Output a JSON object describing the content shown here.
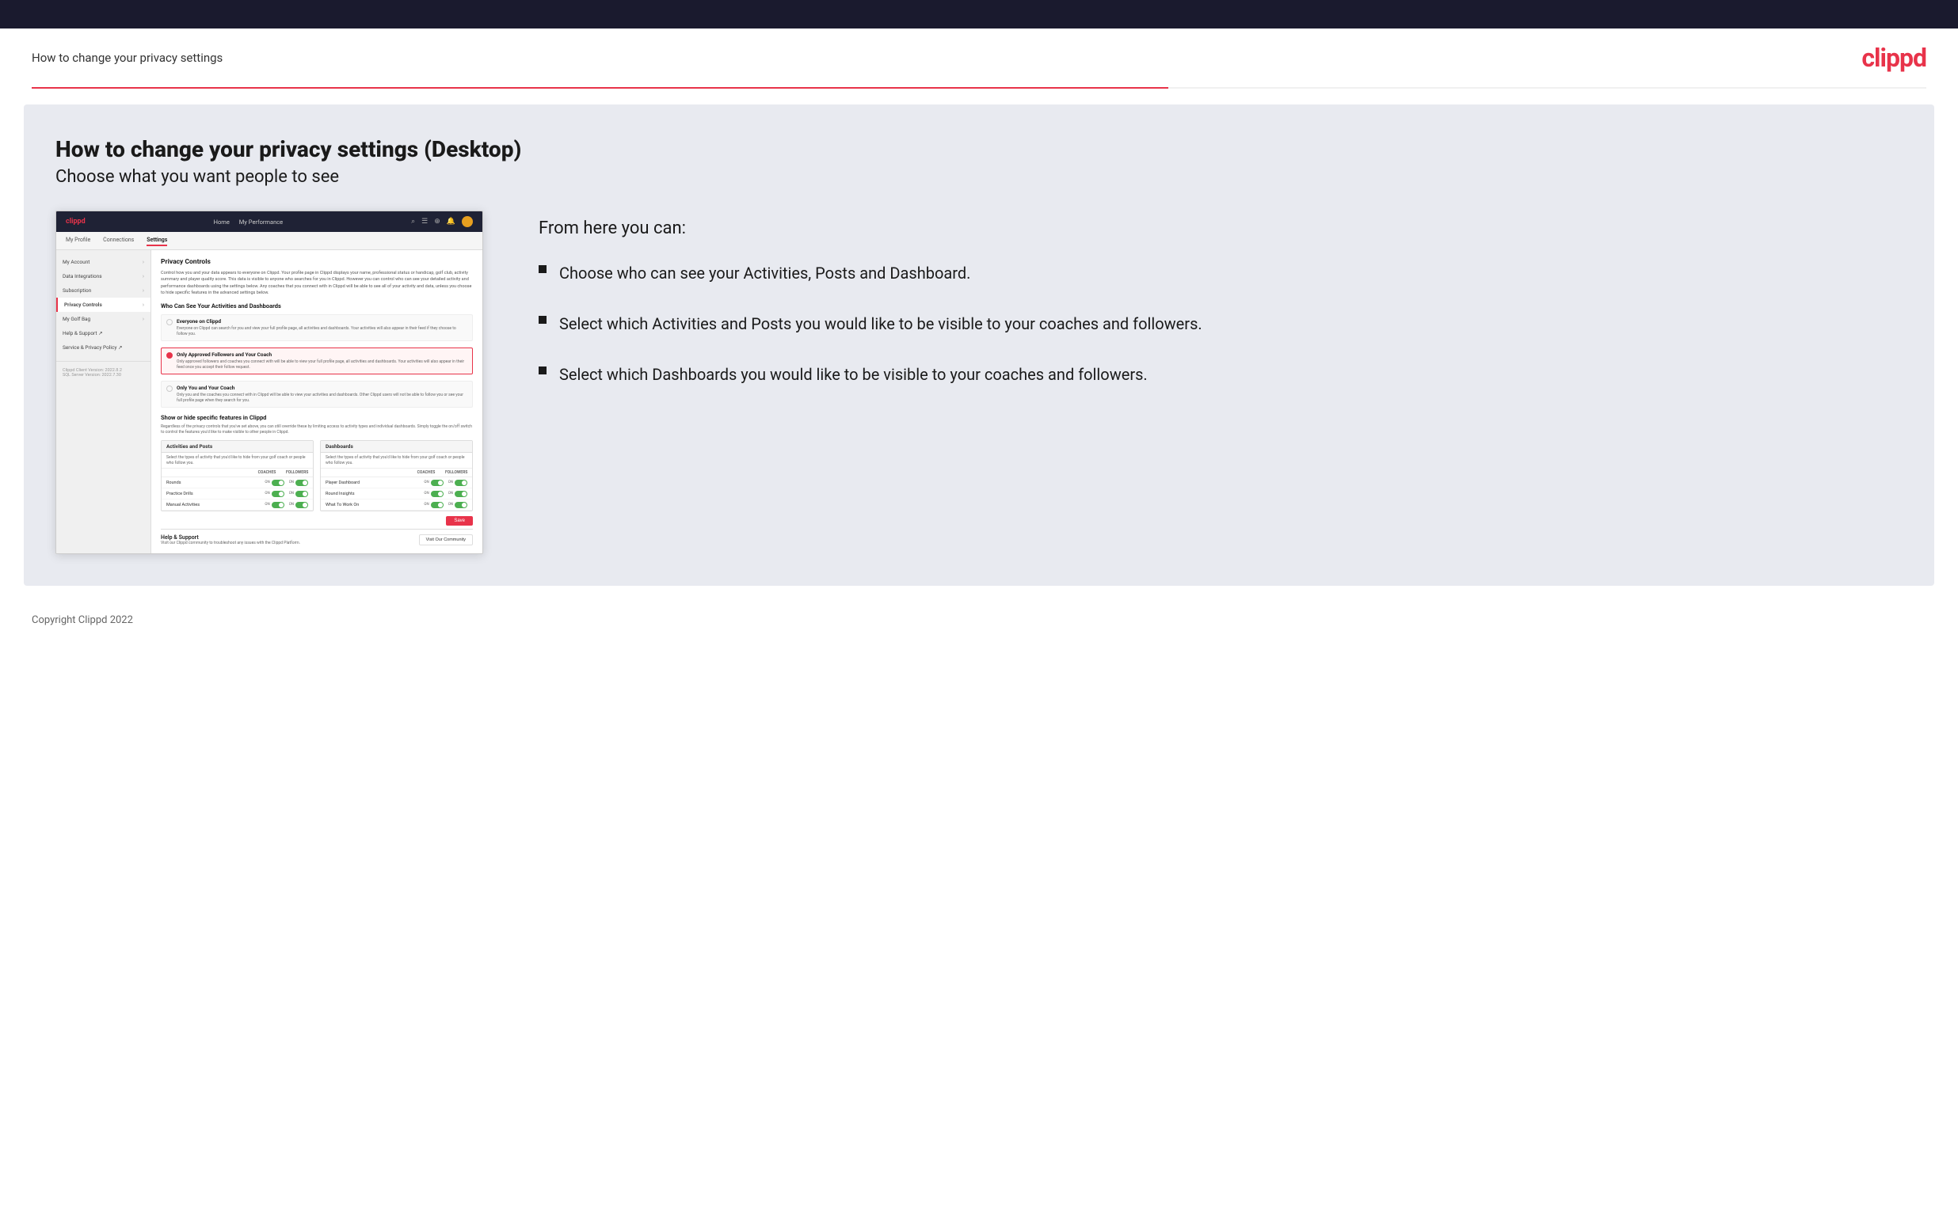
{
  "topBar": {},
  "header": {
    "title": "How to change your privacy settings",
    "logo": "clippd"
  },
  "page": {
    "heading": "How to change your privacy settings (Desktop)",
    "subheading": "Choose what you want people to see"
  },
  "rightPanel": {
    "fromHereTitle": "From here you can:",
    "bullets": [
      {
        "text": "Choose who can see your Activities, Posts and Dashboard."
      },
      {
        "text": "Select which Activities and Posts you would like to be visible to your coaches and followers."
      },
      {
        "text": "Select which Dashboards you would like to be visible to your coaches and followers."
      }
    ]
  },
  "appScreenshot": {
    "navbar": {
      "logo": "clippd",
      "links": [
        "Home",
        "My Performance"
      ],
      "icons": [
        "search",
        "grid",
        "globe",
        "bell"
      ]
    },
    "subnav": {
      "items": [
        "My Profile",
        "Connections",
        "Settings"
      ]
    },
    "sidebar": {
      "items": [
        {
          "label": "My Account",
          "active": false
        },
        {
          "label": "Data Integrations",
          "active": false
        },
        {
          "label": "Subscription",
          "active": false
        },
        {
          "label": "Privacy Controls",
          "active": true
        },
        {
          "label": "My Golf Bag",
          "active": false
        },
        {
          "label": "Help & Support",
          "active": false
        },
        {
          "label": "Service & Privacy Policy",
          "active": false
        }
      ],
      "footer": "Clippd Client Version: 2022.8.2\nSQL Server Version: 2022.7.30"
    },
    "main": {
      "sectionTitle": "Privacy Controls",
      "description": "Control how you and your data appears to everyone on Clippd. Your profile page in Clippd displays your name, professional status or handicap, golf club, activity summary and player quality score. This data is visible to anyone who searches for you in Clippd. However you can control who can see your detailed activity and performance dashboards using the settings below. Any coaches that you connect with in Clippd will be able to see all of your activity and data, unless you choose to hide specific features in the advanced settings below.",
      "whoTitle": "Who Can See Your Activities and Dashboards",
      "radioOptions": [
        {
          "label": "Everyone on Clippd",
          "description": "Everyone on Clippd can search for you and view your full profile page, all activities and dashboards. Your activities will also appear in their feed if they choose to follow you.",
          "selected": false
        },
        {
          "label": "Only Approved Followers and Your Coach",
          "description": "Only approved followers and coaches you connect with will be able to view your full profile page, all activities and dashboards. Your activities will also appear in their feed once you accept their follow request.",
          "selected": true
        },
        {
          "label": "Only You and Your Coach",
          "description": "Only you and the coaches you connect with in Clippd will be able to view your activities and dashboards. Other Clippd users will not be able to follow you or see your full profile page when they search for you.",
          "selected": false
        }
      ],
      "showHideTitle": "Show or hide specific features in Clippd",
      "showHideDesc": "Regardless of the privacy controls that you've set above, you can still override these by limiting access to activity types and individual dashboards. Simply toggle the on/off switch to control the features you'd like to make visible to other people in Clippd.",
      "activitiesCol": {
        "title": "Activities and Posts",
        "desc": "Select the types of activity that you'd like to hide from your golf coach or people who follow you.",
        "labels": [
          "COACHES",
          "FOLLOWERS"
        ],
        "rows": [
          {
            "label": "Rounds",
            "coaches": "ON",
            "followers": "ON"
          },
          {
            "label": "Practice Drills",
            "coaches": "ON",
            "followers": "ON"
          },
          {
            "label": "Manual Activities",
            "coaches": "ON",
            "followers": "ON"
          }
        ]
      },
      "dashboardsCol": {
        "title": "Dashboards",
        "desc": "Select the types of activity that you'd like to hide from your golf coach or people who follow you.",
        "labels": [
          "COACHES",
          "FOLLOWERS"
        ],
        "rows": [
          {
            "label": "Player Dashboard",
            "coaches": "ON",
            "followers": "ON"
          },
          {
            "label": "Round Insights",
            "coaches": "ON",
            "followers": "ON"
          },
          {
            "label": "What To Work On",
            "coaches": "ON",
            "followers": "ON"
          }
        ]
      },
      "saveLabel": "Save",
      "helpSection": {
        "title": "Help & Support",
        "desc": "Visit our Clippd community to troubleshoot any issues with the Clippd Platform.",
        "communityBtn": "Visit Our Community"
      }
    }
  },
  "footer": {
    "copyright": "Copyright Clippd 2022"
  }
}
